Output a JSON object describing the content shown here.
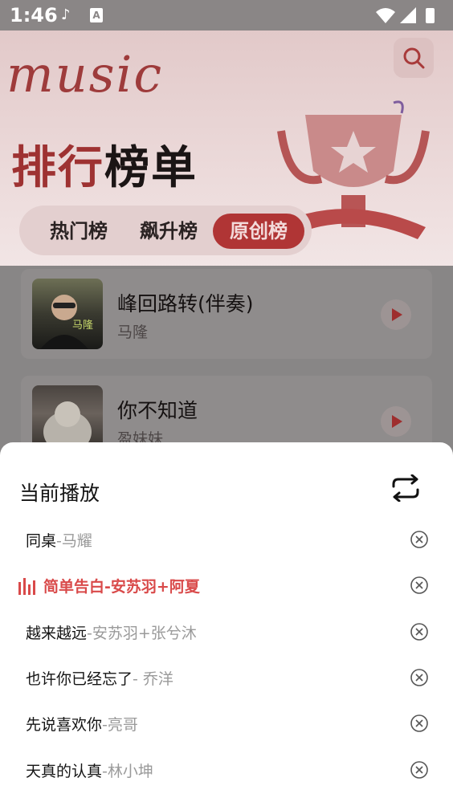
{
  "status_bar": {
    "time": "1:46"
  },
  "header": {
    "logo_text": "music",
    "search_icon": "search-icon"
  },
  "page_title": {
    "part1": "排行",
    "part2": "榜单"
  },
  "tabs": [
    {
      "label": "热门榜",
      "active": false
    },
    {
      "label": "飙升榜",
      "active": false
    },
    {
      "label": "原创榜",
      "active": true
    }
  ],
  "chart_list": [
    {
      "title": "峰回路转(伴奏)",
      "artist": "马隆",
      "cover_text": "马隆"
    },
    {
      "title": "你不知道",
      "artist": "盈妹妹"
    }
  ],
  "now_playing": {
    "title": "当前播放",
    "mode_icon": "repeat-icon",
    "queue": [
      {
        "song": "同桌",
        "sep": "-",
        "artist": "马耀",
        "playing": false
      },
      {
        "song": "简单告白",
        "sep": "-",
        "artist": "安苏羽+阿夏",
        "playing": true
      },
      {
        "song": "越来越远",
        "sep": "-",
        "artist": "安苏羽+张兮沐",
        "playing": false
      },
      {
        "song": "也许你已经忘了",
        "sep": "- ",
        "artist": "乔洋",
        "playing": false
      },
      {
        "song": "先说喜欢你",
        "sep": "-",
        "artist": "亮哥",
        "playing": false
      },
      {
        "song": "天真的认真",
        "sep": "-",
        "artist": "林小坤",
        "playing": false
      }
    ]
  },
  "colors": {
    "accent": "#d94a4a",
    "dim_overlay": "#8d8a8a"
  }
}
